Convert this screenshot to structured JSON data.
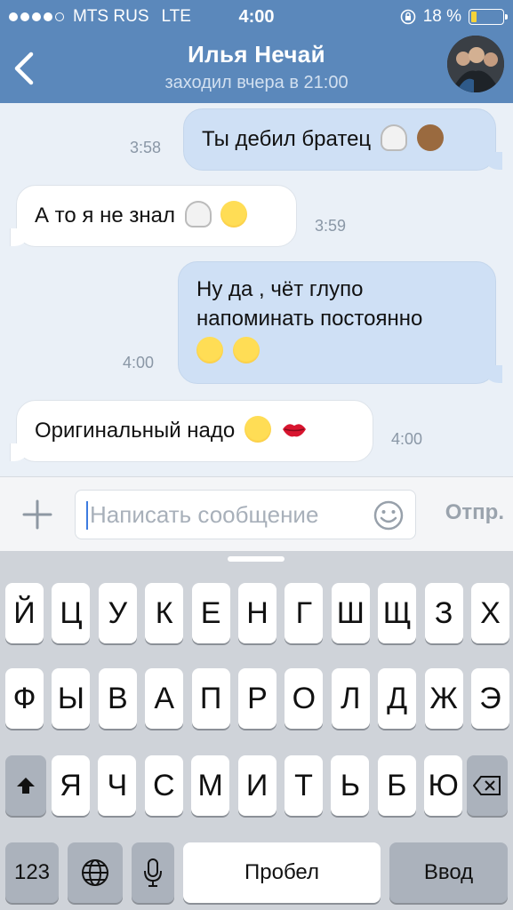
{
  "status_bar": {
    "carrier": "MTS RUS",
    "network": "LTE",
    "time": "4:00",
    "battery": "18 %",
    "battery_level": 0.18,
    "signal_bars_filled": 4,
    "signal_bars_total": 5
  },
  "header": {
    "title": "Илья Нечай",
    "subtitle": "заходил вчера в 21:00",
    "colors": {
      "header_bg": "#5b88bb"
    }
  },
  "messages": [
    {
      "direction": "out",
      "text": "Ты дебил братец",
      "emojis": [
        "ghost-emoji",
        "see-no-evil-monkey-emoji"
      ],
      "time": "3:58"
    },
    {
      "direction": "in",
      "text": "А то я не знал",
      "emojis": [
        "ghost-emoji",
        "tears-of-joy-emoji"
      ],
      "time": "3:59"
    },
    {
      "direction": "out",
      "text_lines": [
        "Ну да , чёт глупо",
        "напоминать постоянно"
      ],
      "emojis": [
        "tears-of-joy-emoji",
        "kissing-heart-emoji"
      ],
      "time": "4:00"
    },
    {
      "direction": "in",
      "text": "Оригинальный надо",
      "emojis": [
        "tears-of-joy-emoji",
        "lips-kiss-emoji"
      ],
      "time": "4:00"
    }
  ],
  "input_bar": {
    "placeholder": "Написать сообщение",
    "send_label": "Отпр."
  },
  "keyboard": {
    "row1": [
      "Й",
      "Ц",
      "У",
      "К",
      "Е",
      "Н",
      "Г",
      "Ш",
      "Щ",
      "З",
      "Х"
    ],
    "row2": [
      "Ф",
      "Ы",
      "В",
      "А",
      "П",
      "Р",
      "О",
      "Л",
      "Д",
      "Ж",
      "Э"
    ],
    "row3": [
      "Я",
      "Ч",
      "С",
      "М",
      "И",
      "Т",
      "Ь",
      "Б",
      "Ю"
    ],
    "numbers_label": "123",
    "space_label": "Пробел",
    "enter_label": "Ввод"
  }
}
